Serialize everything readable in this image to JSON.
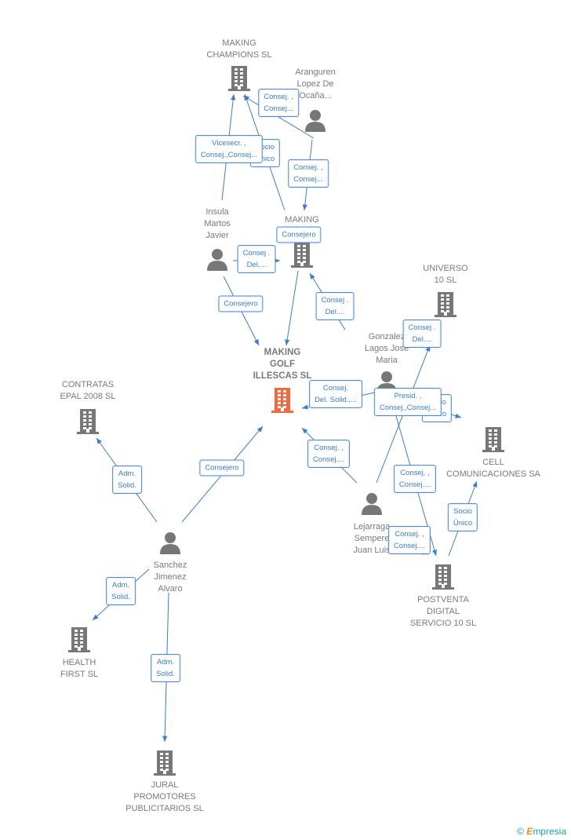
{
  "colors": {
    "building": "#777777",
    "focus_building": "#f26a3c",
    "person": "#777777",
    "edge": "#3b7bd8"
  },
  "nodes": [
    {
      "id": "champions",
      "type": "building",
      "lines": [
        "MAKING",
        "CHAMPIONS SL"
      ]
    },
    {
      "id": "aranguren",
      "type": "person",
      "lines": [
        "Aranguren",
        "Lopez De",
        "Ocaña..."
      ]
    },
    {
      "id": "making",
      "type": "building",
      "lines": [
        "MAKING"
      ]
    },
    {
      "id": "insula",
      "type": "person",
      "lines": [
        "Insula",
        "Martos",
        "Javier"
      ]
    },
    {
      "id": "golf",
      "type": "focus",
      "lines": [
        "MAKING",
        "GOLF",
        "ILLESCAS SL"
      ]
    },
    {
      "id": "universo",
      "type": "building",
      "lines": [
        "UNIVERSO",
        "10 SL"
      ]
    },
    {
      "id": "gonzalez",
      "type": "person",
      "lines": [
        "Gonzalez",
        "Lagos Jose",
        "Maria"
      ]
    },
    {
      "id": "contratas",
      "type": "building",
      "lines": [
        "CONTRATAS",
        "EPAL 2008 SL"
      ]
    },
    {
      "id": "cell",
      "type": "building",
      "lines": [
        "CELL",
        "COMUNICACIONES SA"
      ]
    },
    {
      "id": "lejarraga",
      "type": "person",
      "lines": [
        "Lejarraga",
        "Sempere",
        "Juan Luis"
      ]
    },
    {
      "id": "sanchez",
      "type": "person",
      "lines": [
        "Sanchez",
        "Jimenez",
        "Alvaro"
      ]
    },
    {
      "id": "postventa",
      "type": "building",
      "lines": [
        "POSTVENTA",
        "DIGITAL",
        "SERVICIO 10 SL"
      ]
    },
    {
      "id": "health",
      "type": "building",
      "lines": [
        "HEALTH",
        "FIRST  SL"
      ]
    },
    {
      "id": "jural",
      "type": "building",
      "lines": [
        "JURAL",
        "PROMOTORES",
        "PUBLICITARIOS SL"
      ]
    }
  ],
  "edges": [
    {
      "from": "aranguren",
      "to": "champions",
      "lines": [
        "Consej. ,",
        "Consej..."
      ]
    },
    {
      "from": "making",
      "to": "champions",
      "lines": [
        "Socio",
        "Único"
      ]
    },
    {
      "from": "insula",
      "to": "champions",
      "lines": [
        "Vicesecr. ,",
        "Consej.,Consej..."
      ]
    },
    {
      "from": "aranguren",
      "to": "making",
      "lines": [
        "Consej. ,",
        "Consej..."
      ]
    },
    {
      "from": "making",
      "to": "golf",
      "lines": [
        "Consejero"
      ]
    },
    {
      "from": "insula",
      "to": "making",
      "lines": [
        "Consej .",
        "Del...."
      ]
    },
    {
      "from": "insula",
      "to": "golf",
      "lines": [
        "Consejero"
      ]
    },
    {
      "from": "gonzalez",
      "to": "making",
      "lines": [
        "Consej .",
        "Del...."
      ]
    },
    {
      "from": "lejarraga",
      "to": "universo",
      "lines": [
        "Consej .",
        "Del...."
      ]
    },
    {
      "from": "gonzalez",
      "to": "golf",
      "lines": [
        "Consej.",
        "Del. Solid.,..."
      ]
    },
    {
      "from": "universo",
      "to": "cell",
      "lines": [
        "Socio",
        "Único"
      ]
    },
    {
      "from": "gonzalez",
      "to": "cell",
      "lines": [
        "Presid. ,",
        "Consej.,Consej..."
      ]
    },
    {
      "from": "lejarraga",
      "to": "golf",
      "lines": [
        "Consej. ,",
        "Consej...."
      ]
    },
    {
      "from": "gonzalez",
      "to": "postventa",
      "lines": [
        "Consej. ,",
        "Consej...."
      ]
    },
    {
      "from": "postventa",
      "to": "cell",
      "lines": [
        "Socio",
        "Único"
      ]
    },
    {
      "from": "lejarraga",
      "to": "postventa",
      "lines": [
        "Consej. ,",
        "Consej...."
      ]
    },
    {
      "from": "sanchez",
      "to": "contratas",
      "lines": [
        "Adm.",
        "Solid."
      ]
    },
    {
      "from": "sanchez",
      "to": "golf",
      "lines": [
        "Consejero"
      ]
    },
    {
      "from": "sanchez",
      "to": "health",
      "lines": [
        "Adm.",
        "Solid."
      ]
    },
    {
      "from": "sanchez",
      "to": "jural",
      "lines": [
        "Adm.",
        "Solid."
      ]
    }
  ],
  "footer": {
    "copyright": "©",
    "brand_first": "E",
    "brand_rest": "mpresia"
  }
}
